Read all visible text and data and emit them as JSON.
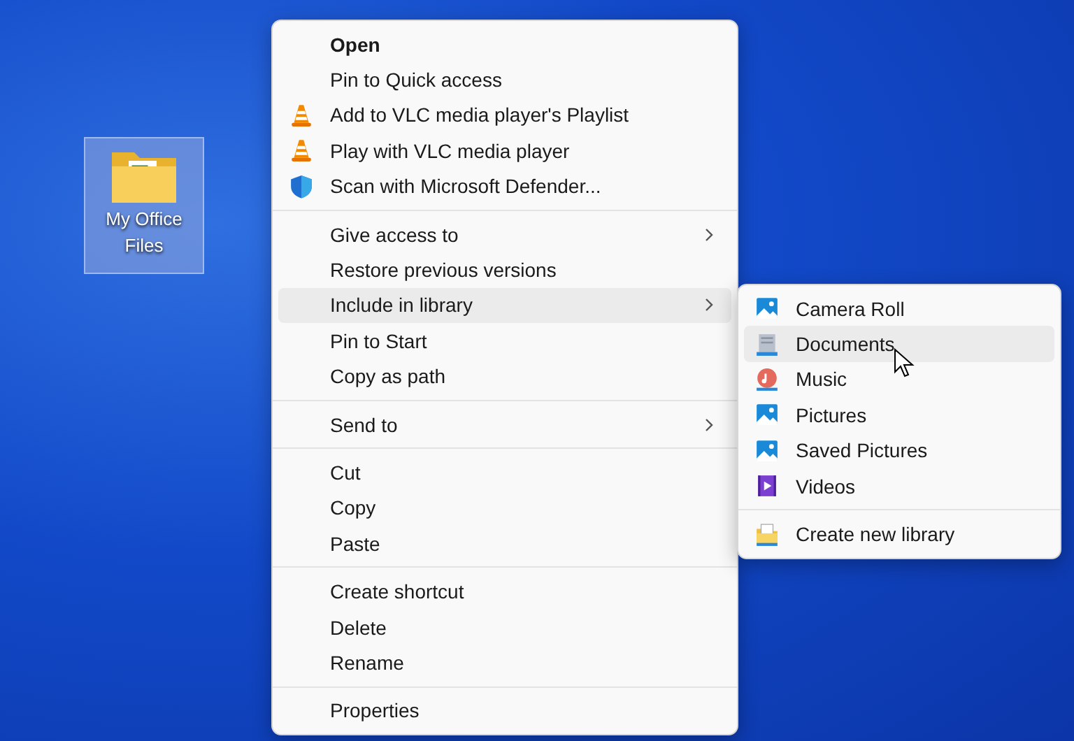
{
  "desktop_icon": {
    "label": "My Office Files",
    "selected": true
  },
  "context_menu": {
    "groups": [
      [
        {
          "label": "Open",
          "kind": "plain",
          "default": true,
          "highlighted": false,
          "submenu": false
        },
        {
          "label": "Pin to Quick access",
          "kind": "plain",
          "default": false,
          "highlighted": false,
          "submenu": false
        },
        {
          "label": "Add to VLC media player's Playlist",
          "kind": "vlc",
          "default": false,
          "highlighted": false,
          "submenu": false
        },
        {
          "label": "Play with VLC media player",
          "kind": "vlc",
          "default": false,
          "highlighted": false,
          "submenu": false
        },
        {
          "label": "Scan with Microsoft Defender...",
          "kind": "shield",
          "default": false,
          "highlighted": false,
          "submenu": false
        }
      ],
      [
        {
          "label": "Give access to",
          "kind": "plain",
          "default": false,
          "highlighted": false,
          "submenu": true
        },
        {
          "label": "Restore previous versions",
          "kind": "plain",
          "default": false,
          "highlighted": false,
          "submenu": false
        },
        {
          "label": "Include in library",
          "kind": "plain",
          "default": false,
          "highlighted": true,
          "submenu": true
        },
        {
          "label": "Pin to Start",
          "kind": "plain",
          "default": false,
          "highlighted": false,
          "submenu": false
        },
        {
          "label": "Copy as path",
          "kind": "plain",
          "default": false,
          "highlighted": false,
          "submenu": false
        }
      ],
      [
        {
          "label": "Send to",
          "kind": "plain",
          "default": false,
          "highlighted": false,
          "submenu": true
        }
      ],
      [
        {
          "label": "Cut",
          "kind": "plain",
          "default": false,
          "highlighted": false,
          "submenu": false
        },
        {
          "label": "Copy",
          "kind": "plain",
          "default": false,
          "highlighted": false,
          "submenu": false
        },
        {
          "label": "Paste",
          "kind": "plain",
          "default": false,
          "highlighted": false,
          "submenu": false
        }
      ],
      [
        {
          "label": "Create shortcut",
          "kind": "plain",
          "default": false,
          "highlighted": false,
          "submenu": false
        },
        {
          "label": "Delete",
          "kind": "plain",
          "default": false,
          "highlighted": false,
          "submenu": false
        },
        {
          "label": "Rename",
          "kind": "plain",
          "default": false,
          "highlighted": false,
          "submenu": false
        }
      ],
      [
        {
          "label": "Properties",
          "kind": "plain",
          "default": false,
          "highlighted": false,
          "submenu": false
        }
      ]
    ]
  },
  "library_submenu": {
    "groups": [
      [
        {
          "label": "Camera Roll",
          "kind": "picture",
          "highlighted": false
        },
        {
          "label": "Documents",
          "kind": "document",
          "highlighted": true
        },
        {
          "label": "Music",
          "kind": "music",
          "highlighted": false
        },
        {
          "label": "Pictures",
          "kind": "picture",
          "highlighted": false
        },
        {
          "label": "Saved Pictures",
          "kind": "picture",
          "highlighted": false
        },
        {
          "label": "Videos",
          "kind": "video",
          "highlighted": false
        }
      ],
      [
        {
          "label": "Create new library",
          "kind": "library",
          "highlighted": false
        }
      ]
    ]
  }
}
